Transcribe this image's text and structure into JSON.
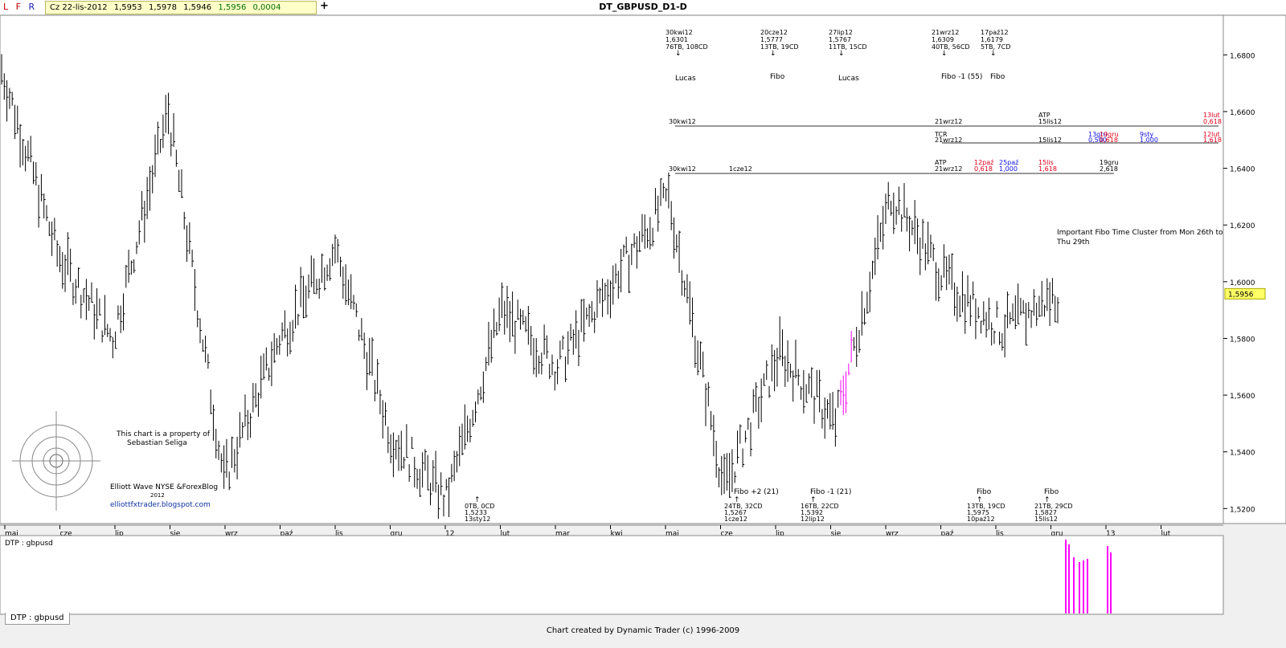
{
  "header": {
    "title": "DT_GBPUSD_D1-D",
    "lfr": [
      "L",
      "F",
      "R"
    ],
    "ohlc_date": "Cz 22-lis-2012",
    "ohlc_open": "1,5953",
    "ohlc_high": "1,5978",
    "ohlc_low": "1,5946",
    "ohlc_close": "1,5956",
    "ohlc_change": "0,0004",
    "add_label": "+"
  },
  "colors": {
    "bars": "#000000",
    "highlight": "#ff00ff",
    "red": "#e0001a",
    "blue": "#1010e0",
    "price_tag": "#ffff66"
  },
  "chart_data": {
    "type": "bar",
    "title": "DT_GBPUSD_D1-D",
    "ylim": [
      1.515,
      1.69
    ],
    "yticks": [
      "1,5200",
      "1,5400",
      "1,5600",
      "1,5800",
      "1,6000",
      "1,6200",
      "1,6400",
      "1,6600",
      "1,6800"
    ],
    "last_price": "1,5956",
    "x_labels": [
      "maj",
      "cze",
      "lip",
      "sie",
      "wrz",
      "paź",
      "lis",
      "gru",
      "12",
      "lut",
      "mar",
      "kwi",
      "maj",
      "cze",
      "lip",
      "sie",
      "wrz",
      "paź",
      "lis",
      "gru",
      "13",
      "lut"
    ],
    "swing_points_approx": [
      {
        "date": "maj",
        "price": 1.675
      },
      {
        "date": "cze",
        "price": 1.61
      },
      {
        "date": "lip",
        "price": 1.58
      },
      {
        "date": "sie",
        "price": 1.66
      },
      {
        "date": "wrz",
        "price": 1.53
      },
      {
        "date": "paź",
        "price": 1.58
      },
      {
        "date": "lis",
        "price": 1.612
      },
      {
        "date": "gru",
        "price": 1.546
      },
      {
        "date": "12",
        "price": 1.523
      },
      {
        "date": "lut",
        "price": 1.59
      },
      {
        "date": "mar",
        "price": 1.57
      },
      {
        "date": "kwi",
        "price": 1.6
      },
      {
        "date": "maj",
        "price": 1.63
      },
      {
        "date": "cze",
        "price": 1.527
      },
      {
        "date": "lip",
        "price": 1.575
      },
      {
        "date": "sie",
        "price": 1.55
      },
      {
        "date": "wrz",
        "price": 1.631
      },
      {
        "date": "paź",
        "price": 1.6
      },
      {
        "date": "lis",
        "price": 1.583
      },
      {
        "date": "gru",
        "price": 1.5956
      }
    ],
    "top_annotations": [
      {
        "date": "30kwi12",
        "price": "1,6301",
        "counts": "76TB, 108CD",
        "label": "Lucas"
      },
      {
        "date": "20cze12",
        "price": "1,5777",
        "counts": "13TB, 19CD",
        "label": "Fibo"
      },
      {
        "date": "27lip12",
        "price": "1,5767",
        "counts": "11TB, 15CD",
        "label": "Lucas"
      },
      {
        "date": "21wrz12",
        "price": "1,6309",
        "counts": "40TB, 56CD",
        "label": "Fibo -1 (55)"
      },
      {
        "date": "17paź12",
        "price": "1,6179",
        "counts": "5TB, 7CD",
        "label": "Fibo"
      }
    ],
    "bottom_annotations": [
      {
        "counts": "0TB, 0CD",
        "price": "1,5233",
        "date": "13sty12",
        "label": ""
      },
      {
        "counts": "24TB, 32CD",
        "price": "1,5267",
        "date": "1cze12",
        "label": "Fibo +2 (21)"
      },
      {
        "counts": "16TB, 22CD",
        "price": "1,5392",
        "date": "12lip12",
        "label": "Fibo -1 (21)"
      },
      {
        "counts": "13TB, 19CD",
        "price": "1,5975",
        "date": "10paź12",
        "label": "Fibo"
      },
      {
        "counts": "21TB, 29CD",
        "price": "1,5827",
        "date": "15lis12",
        "label": "Fibo"
      }
    ],
    "projection_rows": [
      {
        "left": "30kwi12",
        "mid": "21wrz12",
        "right_top": "ATP",
        "right": "15lis12",
        "red_top": "13lut",
        "red": "0,618"
      },
      {
        "left": "TCR",
        "mid": "21wrz12",
        "right": "15lis12",
        "blue1": "13gru",
        "blue1v": "0,500",
        "red1": "19gru",
        "red1v": "0,618",
        "blue2": "9sty",
        "blue2v": "1,000",
        "red2": "12lut",
        "red2v": "1,618"
      },
      {
        "left": "30kwi12",
        "mid2": "1cze12",
        "mid_top": "ATP",
        "mid": "21wrz12",
        "red1": "12paź",
        "red1v": "0,618",
        "blue1": "25paź",
        "blue1v": "1,000",
        "red2": "15lis",
        "red2v": "1,618",
        "blk": "19gru",
        "blkv": "2,618"
      }
    ],
    "cluster_note": "Important Fibo Time Cluster from Mon 26th to Thu 29th",
    "copyright": [
      "This chart is a property of",
      "Sebastian Seliga"
    ],
    "blog": [
      "Elliott Wave NYSE &ForexBlog",
      "2012",
      "elliottfxtrader.blogspot.com"
    ]
  },
  "lower_panel": {
    "title": "DTP : gbpusd",
    "tab": "DTP : gbpusd"
  },
  "footer": {
    "text": "Chart created by Dynamic Trader  (c) 1996-2009"
  }
}
